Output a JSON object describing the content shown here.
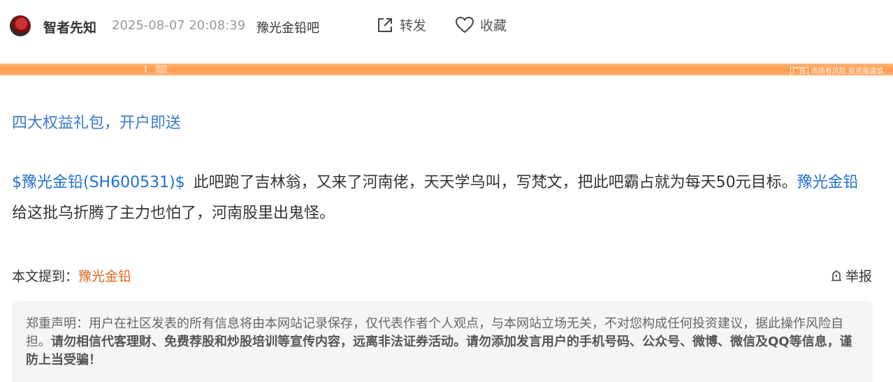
{
  "post": {
    "author": "智者先知",
    "timestamp": "2025-08-07 20:08:39",
    "forum": "豫光金铅吧",
    "share_label": "转发",
    "favorite_label": "收藏"
  },
  "ad": {
    "tag": "广告",
    "note": "市场有风险 投资需谨慎"
  },
  "promo_link": "四大权益礼包，开户即送",
  "content": {
    "stock_link": "$豫光金铅(SH600531)$",
    "text1": "此吧跑了吉林翁，又来了河南佬，天天学乌叫，写梵文，把此吧霸占就为每天50元目标。",
    "stock_name_link": "豫光金铅",
    "text2": "给这批乌折腾了主力也怕了，河南股里出鬼怪。"
  },
  "mentions": {
    "label": "本文提到：",
    "stock": "豫光金铅"
  },
  "report_label": "举报",
  "disclaimer": {
    "normal": "郑重声明：用户在社区发表的所有信息将由本网站记录保存，仅代表作者个人观点，与本网站立场无关，不对您构成任何投资建议，据此操作风险自担。",
    "bold": "请勿相信代客理财、免费荐股和炒股培训等宣传内容，远离非法证券活动。请勿添加发言用户的手机号码、公众号、微博、微信及QQ等信息，谨防上当受骗！"
  },
  "icons": {
    "share": "share-icon",
    "favorite": "heart-icon",
    "report": "alert-bell-icon"
  },
  "colors": {
    "link_blue": "#1e6fd1",
    "mention_orange": "#e0661a",
    "ad_orange": "#ff9a4c"
  }
}
